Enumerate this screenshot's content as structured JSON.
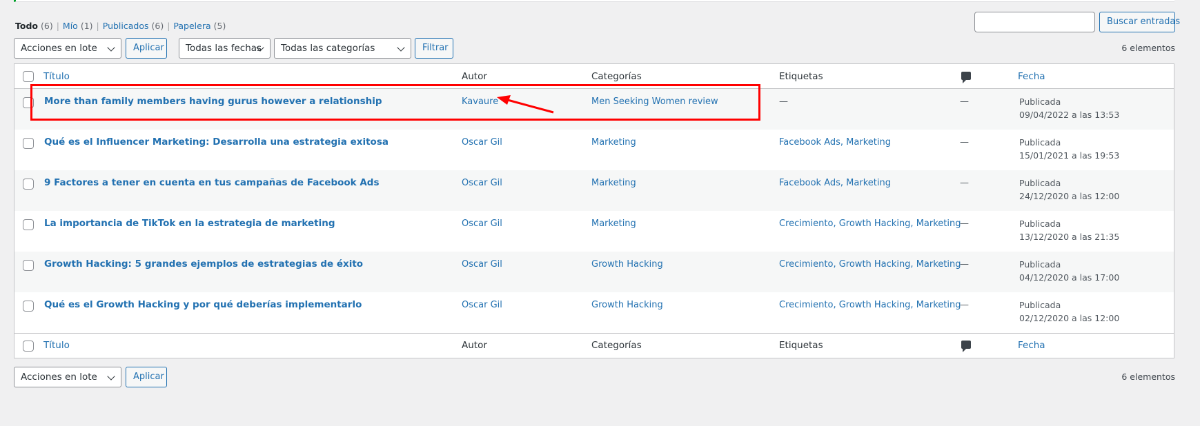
{
  "filters": {
    "all_label": "Todo",
    "all_count": "(6)",
    "mine_label": "Mío",
    "mine_count": "(1)",
    "published_label": "Publicados",
    "published_count": "(6)",
    "trash_label": "Papelera",
    "trash_count": "(5)",
    "separator": "|"
  },
  "search": {
    "value": "",
    "button_label": "Buscar entradas"
  },
  "toolbar_top": {
    "bulk_actions": "Acciones en lote",
    "apply_label": "Aplicar",
    "dates": "Todas las fechas",
    "categories": "Todas las categorías",
    "filter_label": "Filtrar",
    "items_count": "6 elementos"
  },
  "table": {
    "columns": {
      "title": "Título",
      "author": "Autor",
      "categories": "Categorías",
      "tags": "Etiquetas",
      "date": "Fecha"
    },
    "rows": [
      {
        "title": "More than family members having gurus however a relationship",
        "author": "Kavaure",
        "categories": "Men Seeking Women review",
        "tags": "—",
        "comments": "—",
        "status": "Publicada",
        "date": "09/04/2022 a las 13:53"
      },
      {
        "title": "Qué es el Influencer Marketing: Desarrolla una estrategia exitosa",
        "author": "Oscar Gil",
        "categories": "Marketing",
        "tags": "Facebook Ads, Marketing",
        "comments": "—",
        "status": "Publicada",
        "date": "15/01/2021 a las 19:53"
      },
      {
        "title": "9 Factores a tener en cuenta en tus campañas de Facebook Ads",
        "author": "Oscar Gil",
        "categories": "Marketing",
        "tags": "Facebook Ads, Marketing",
        "comments": "—",
        "status": "Publicada",
        "date": "24/12/2020 a las 12:00"
      },
      {
        "title": "La importancia de TikTok en la estrategia de marketing",
        "author": "Oscar Gil",
        "categories": "Marketing",
        "tags": "Crecimiento, Growth Hacking, Marketing",
        "comments": "—",
        "status": "Publicada",
        "date": "13/12/2020 a las 21:35"
      },
      {
        "title": "Growth Hacking: 5 grandes ejemplos de estrategias de éxito",
        "author": "Oscar Gil",
        "categories": "Growth Hacking",
        "tags": "Crecimiento, Growth Hacking, Marketing",
        "comments": "—",
        "status": "Publicada",
        "date": "04/12/2020 a las 17:00"
      },
      {
        "title": "Qué es el Growth Hacking y por qué deberías implementarlo",
        "author": "Oscar Gil",
        "categories": "Growth Hacking",
        "tags": "Crecimiento, Growth Hacking, Marketing",
        "comments": "—",
        "status": "Publicada",
        "date": "02/12/2020 a las 12:00"
      }
    ]
  },
  "toolbar_bottom": {
    "bulk_actions": "Acciones en lote",
    "apply_label": "Aplicar",
    "items_count": "6 elementos"
  },
  "colors": {
    "link": "#2271b1",
    "annotation": "#ff0000",
    "notice_accent": "#00a32a"
  },
  "icons": {
    "comments_column": "comment-bubble-icon",
    "dropdown": "chevron-down-icon",
    "annotation": "red-arrow-icon"
  }
}
